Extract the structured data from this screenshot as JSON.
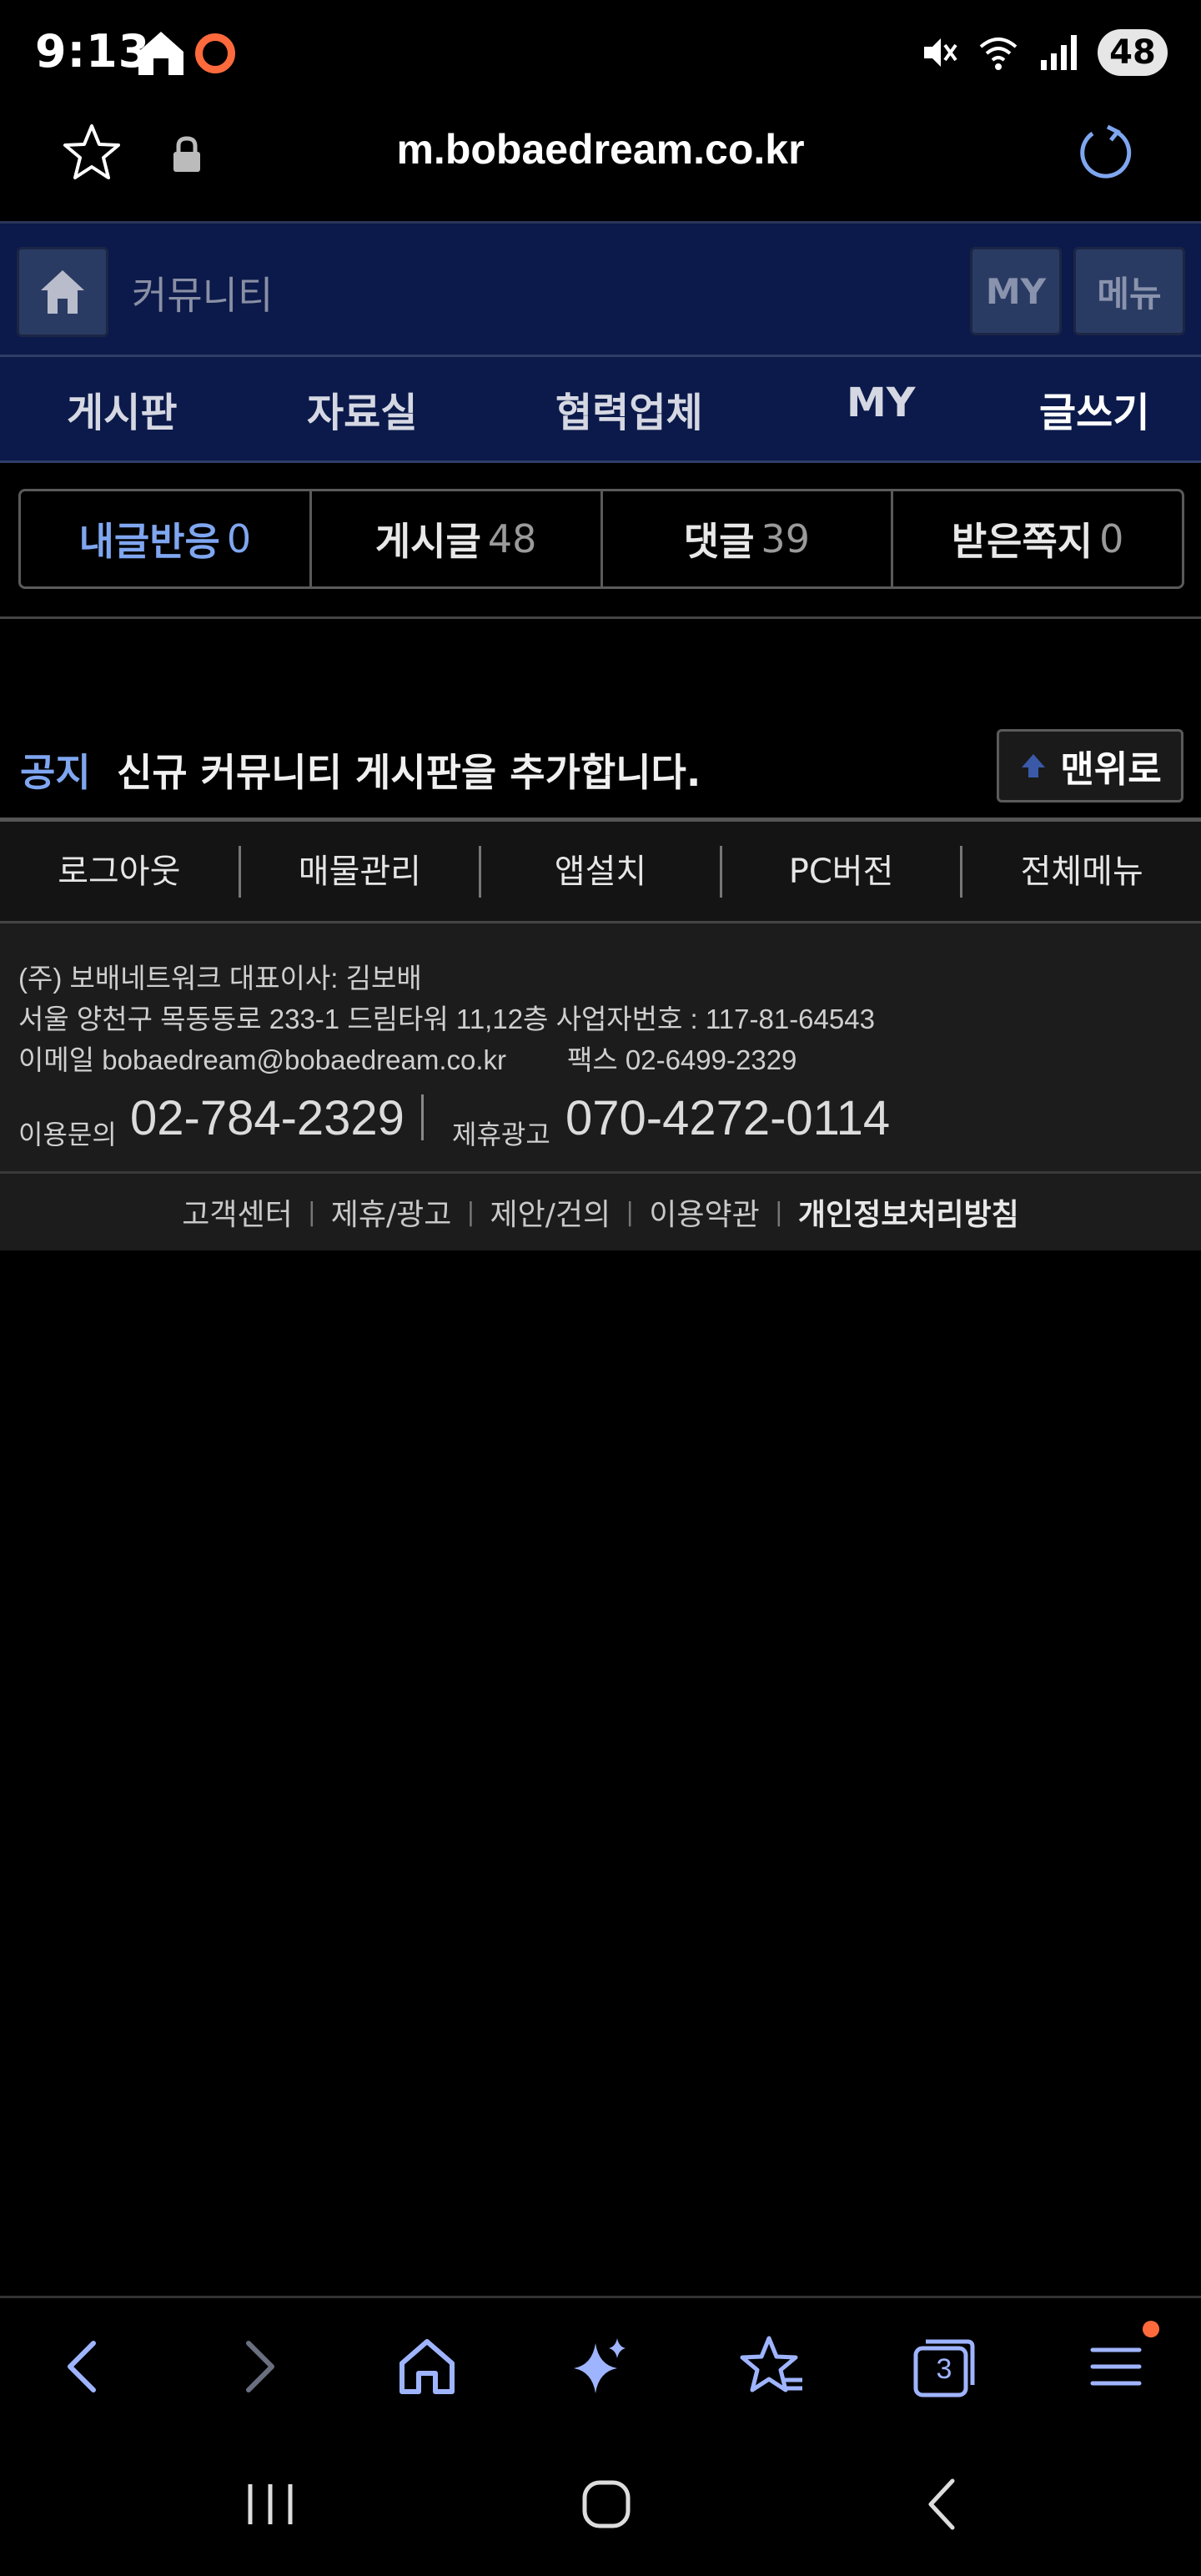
{
  "status_bar": {
    "time": "9:13",
    "battery": "48"
  },
  "address_bar": {
    "url": "m.bobaedream.co.kr"
  },
  "community_header": {
    "title": "커뮤니티",
    "my_label": "MY",
    "menu_label": "메뉴"
  },
  "nav_tabs": [
    {
      "label": "게시판"
    },
    {
      "label": "자료실"
    },
    {
      "label": "협력업체"
    },
    {
      "label": "MY"
    },
    {
      "label": "글쓰기"
    }
  ],
  "counts": [
    {
      "label": "내글반응",
      "value": "0"
    },
    {
      "label": "게시글",
      "value": "48"
    },
    {
      "label": "댓글",
      "value": "39"
    },
    {
      "label": "받은쪽지",
      "value": "0"
    }
  ],
  "notice": {
    "label": "공지",
    "text": "신규 커뮤니티 게시판을 추가합니다.",
    "top_button": "맨위로"
  },
  "footer_links": [
    {
      "label": "로그아웃"
    },
    {
      "label": "매물관리"
    },
    {
      "label": "앱설치"
    },
    {
      "label": "PC버전"
    },
    {
      "label": "전체메뉴"
    }
  ],
  "company": {
    "line1": "(주) 보배네트워크 대표이사: 김보배",
    "line2": "서울 양천구 목동동로 233-1 드림타워 11,12층 사업자번호 : 117-81-64543",
    "line3_email": "이메일 bobaedream@bobaedream.co.kr",
    "line3_fax": "팩스 02-6499-2329",
    "inquiry_label": "이용문의",
    "inquiry_phone": "02-784-2329",
    "ad_label": "제휴광고",
    "ad_phone": "070-4272-0114"
  },
  "bottom_links": [
    {
      "label": "고객센터"
    },
    {
      "label": "제휴/광고"
    },
    {
      "label": "제안/건의"
    },
    {
      "label": "이용약관"
    },
    {
      "label": "개인정보처리방침"
    }
  ],
  "bottom_links_separator": "|",
  "browser_toolbar": {
    "tab_count": "3"
  },
  "colors": {
    "header_bg": "#0b1a4a",
    "accent_blue": "#7fa6f0",
    "notification_dot": "#ff6a3d"
  }
}
